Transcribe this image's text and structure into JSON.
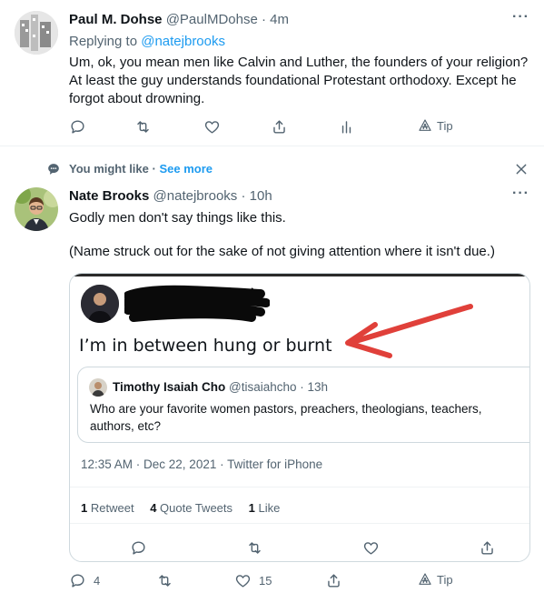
{
  "tweet1": {
    "name": "Paul M. Dohse",
    "handle": "@PaulMDohse",
    "time": "· 4m",
    "replying_label": "Replying to",
    "replying_to": "@natejbrooks",
    "body_lines": [
      "Um, ok, you mean men like Calvin and Luther, the founders of your religion?",
      "At least the guy understands foundational Protestant orthodoxy. Except he",
      "forgot about drowning."
    ],
    "tip_label": "Tip"
  },
  "suggest": {
    "label": "You might like",
    "sep": "·",
    "see_more": "See more"
  },
  "tweet2": {
    "name": "Nate Brooks",
    "handle": "@natejbrooks",
    "time": "· 10h",
    "line1": "Godly men don't say things like this.",
    "line2": "(Name struck out for the sake of not giving attention where it isn't due.)",
    "reply_count": "4",
    "like_count": "15",
    "tip_label": "Tip"
  },
  "embedded": {
    "quote_text": "I’m in between hung or burnt",
    "quoted_name": "Timothy Isaiah Cho",
    "quoted_handle": "@tisaiahcho · 13h",
    "quoted_line1": "Who are your favorite women pastors, preachers, theologians, teachers,",
    "quoted_line2": "authors, etc?",
    "timestamp": "12:35 AM · Dec 22, 2021 · Twitter for iPhone",
    "retweet_count": "1",
    "retweet_label": "Retweet",
    "quote_count": "4",
    "quote_label": "Quote Tweets",
    "like_count": "1",
    "like_label": "Like"
  },
  "colors": {
    "accent": "#1d9bf0",
    "muted": "#536471",
    "arrow": "#e0403a"
  }
}
